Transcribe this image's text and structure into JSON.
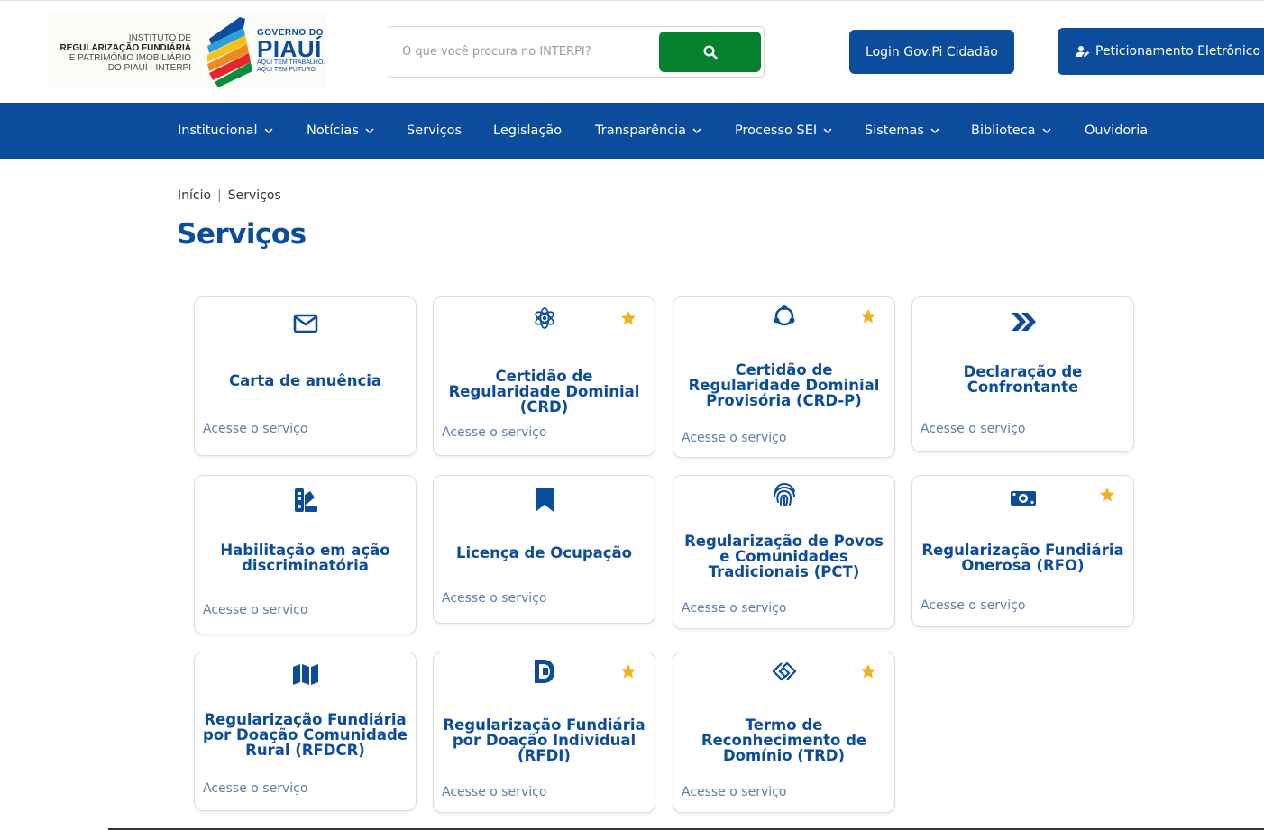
{
  "header": {
    "logo_lines": [
      "INSTITUTO DE",
      "REGULARIZAÇÃO FUNDIÁRIA",
      "E PATRIMÔNIO IMOBILIÁRIO",
      "DO PIAUÍ - INTERPI"
    ],
    "gov_small": "GOVERNO DO",
    "gov_big": "PIAUÍ",
    "gov_tag1": "AQUI TEM TRABALHO.",
    "gov_tag2": "AQUI TEM FUTURO.",
    "search_placeholder": "O que você procura no INTERPI?",
    "login_label": "Login Gov.Pi Cidadão",
    "petic_label": "Peticionamento Eletrônico"
  },
  "nav": {
    "items": [
      {
        "label": "Institucional",
        "dropdown": true
      },
      {
        "label": "Notícias",
        "dropdown": true
      },
      {
        "label": "Serviços",
        "dropdown": false
      },
      {
        "label": "Legislação",
        "dropdown": false
      },
      {
        "label": "Transparência",
        "dropdown": true
      },
      {
        "label": "Processo SEI",
        "dropdown": true
      },
      {
        "label": "Sistemas",
        "dropdown": true
      },
      {
        "label": "Biblioteca",
        "dropdown": true
      },
      {
        "label": "Ouvidoria",
        "dropdown": false
      }
    ]
  },
  "breadcrumb": {
    "home": "Início",
    "current": "Serviços"
  },
  "page_title": "Serviços",
  "cards": [
    {
      "title": "Carta de anuência",
      "link": "Acesse o serviço",
      "icon": "envelope-icon",
      "starred": false
    },
    {
      "title": "Certidão de Regularidade Dominial (CRD)",
      "link": "Acesse o serviço",
      "icon": "atom-icon",
      "starred": true
    },
    {
      "title": "Certidão de Regularidade Dominial Provisória (CRD-P)",
      "link": "Acesse o serviço",
      "icon": "connected-nodes-icon",
      "starred": true
    },
    {
      "title": "Declaração de Confrontante",
      "link": "Acesse o serviço",
      "icon": "forward-chevrons-icon",
      "starred": false
    },
    {
      "title": "Habilitação em ação discriminatória",
      "link": "Acesse o serviço",
      "icon": "swatchbook-icon",
      "starred": false
    },
    {
      "title": "Licença de Ocupação",
      "link": "Acesse o serviço",
      "icon": "bookmark-icon",
      "starred": false
    },
    {
      "title": "Regularização de Povos e Comunidades Tradicionais (PCT)",
      "link": "Acesse o serviço",
      "icon": "fingerprint-icon",
      "starred": false
    },
    {
      "title": "Regularização Fundiária Onerosa (RFO)",
      "link": "Acesse o serviço",
      "icon": "money-bill-icon",
      "starred": true
    },
    {
      "title": "Regularização Fundiária por Doação Comunidade Rural (RFDCR)",
      "link": "Acesse o serviço",
      "icon": "map-icon",
      "starred": false
    },
    {
      "title": "Regularização Fundiária por Doação Individual (RFDI)",
      "link": "Acesse o serviço",
      "icon": "d-logo-icon",
      "starred": true
    },
    {
      "title": "Termo de Reconhecimento de Domínio (TRD)",
      "link": "Acesse o serviço",
      "icon": "linked-diamonds-icon",
      "starred": true
    }
  ],
  "colors": {
    "primary": "#0b4c9c",
    "search_button": "#06822f",
    "star": "#f2b01e",
    "link": "#5f7ea5"
  }
}
